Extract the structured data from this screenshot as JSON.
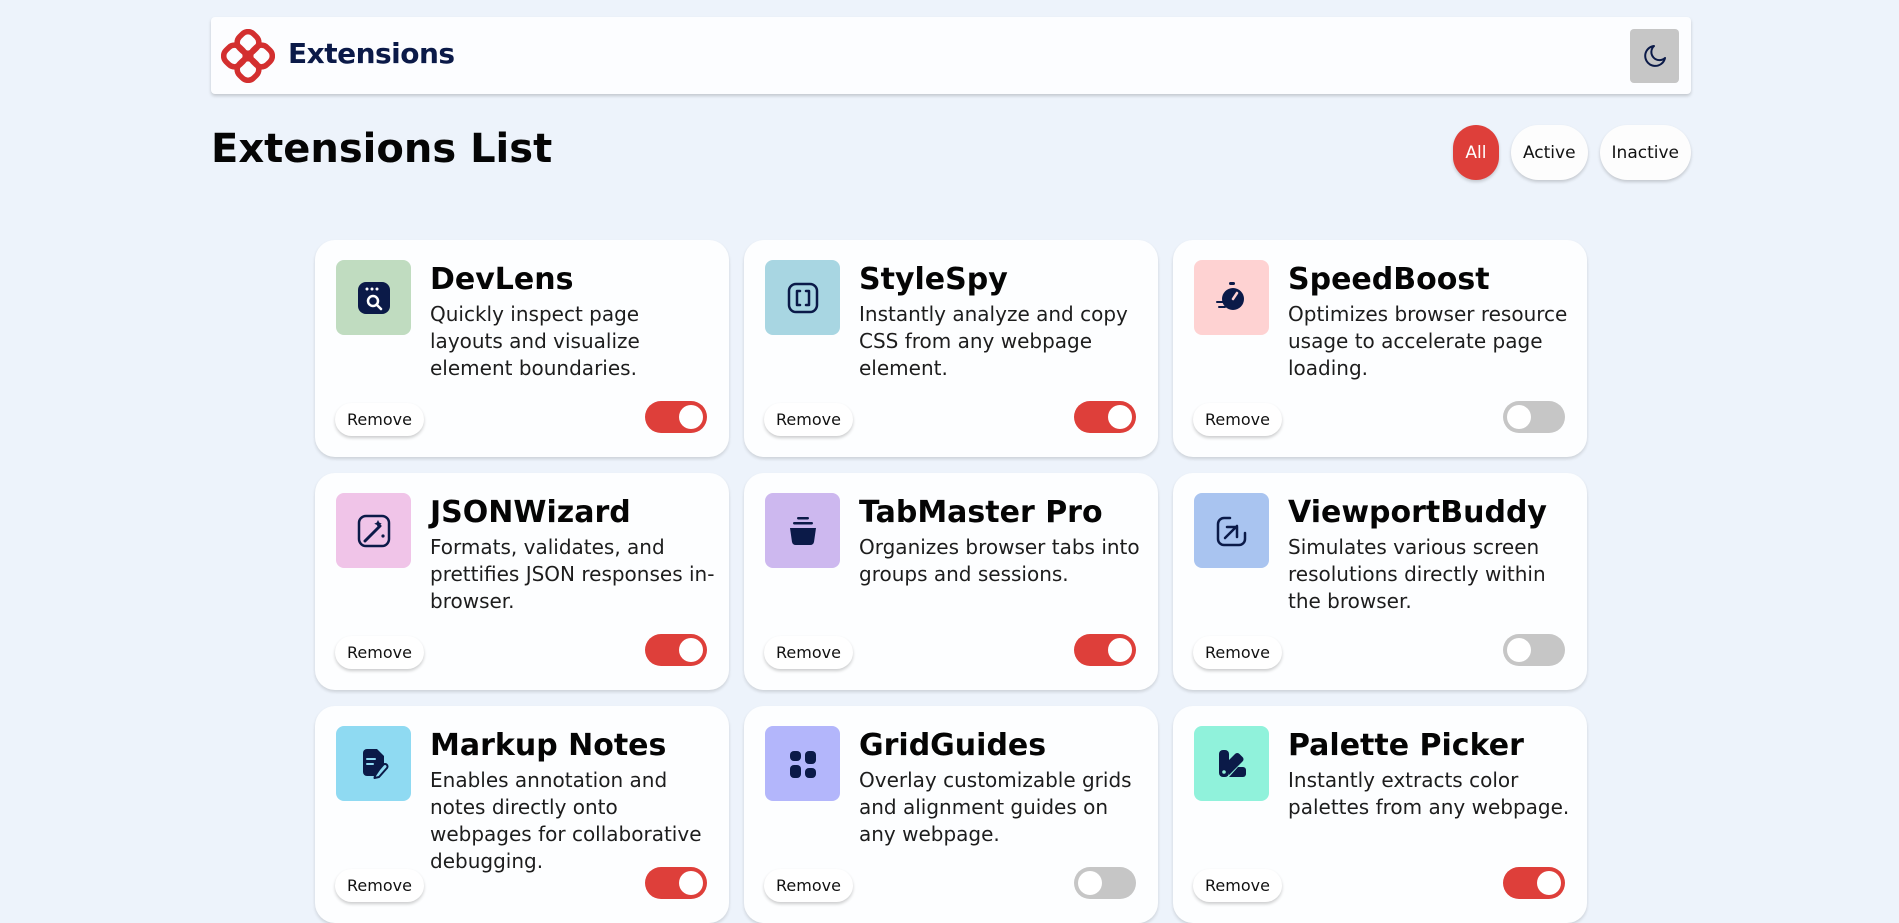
{
  "header": {
    "brand": "Extensions",
    "theme_icon": "moon-icon"
  },
  "page_title": "Extensions List",
  "filters": [
    {
      "label": "All",
      "selected": true
    },
    {
      "label": "Active",
      "selected": false
    },
    {
      "label": "Inactive",
      "selected": false
    }
  ],
  "colors": {
    "accent": "#de3f3a",
    "background": "#edf3fb",
    "toggle_off": "#c6c6c6",
    "brand_dark": "#0b1a48"
  },
  "extensions": [
    {
      "name": "DevLens",
      "description": "Quickly inspect page layouts and visualize element boundaries.",
      "remove_label": "Remove",
      "enabled": true,
      "icon": "devlens-icon",
      "icon_bg": "#c0dcc0"
    },
    {
      "name": "StyleSpy",
      "description": "Instantly analyze and copy CSS from any webpage element.",
      "remove_label": "Remove",
      "enabled": true,
      "icon": "stylespy-icon",
      "icon_bg": "#a8d6e2"
    },
    {
      "name": "SpeedBoost",
      "description": "Optimizes browser resource usage to accelerate page loading.",
      "remove_label": "Remove",
      "enabled": false,
      "icon": "speedboost-icon",
      "icon_bg": "#fed2d2"
    },
    {
      "name": "JSONWizard",
      "description": "Formats, validates, and prettifies JSON responses in-browser.",
      "remove_label": "Remove",
      "enabled": true,
      "icon": "jsonwizard-icon",
      "icon_bg": "#f0c4e8"
    },
    {
      "name": "TabMaster Pro",
      "description": "Organizes browser tabs into groups and sessions.",
      "remove_label": "Remove",
      "enabled": true,
      "icon": "tabmaster-icon",
      "icon_bg": "#cdb8ef"
    },
    {
      "name": "ViewportBuddy",
      "description": "Simulates various screen resolutions directly within the browser.",
      "remove_label": "Remove",
      "enabled": false,
      "icon": "viewportbuddy-icon",
      "icon_bg": "#a9c4f0"
    },
    {
      "name": "Markup Notes",
      "description": "Enables annotation and notes directly onto webpages for collaborative debugging.",
      "remove_label": "Remove",
      "enabled": true,
      "icon": "markup-notes-icon",
      "icon_bg": "#8fdaf2"
    },
    {
      "name": "GridGuides",
      "description": "Overlay customizable grids and alignment guides on any webpage.",
      "remove_label": "Remove",
      "enabled": false,
      "icon": "gridguides-icon",
      "icon_bg": "#b3b6fb"
    },
    {
      "name": "Palette Picker",
      "description": "Instantly extracts color palettes from any webpage.",
      "remove_label": "Remove",
      "enabled": true,
      "icon": "palette-picker-icon",
      "icon_bg": "#90f2db"
    }
  ]
}
